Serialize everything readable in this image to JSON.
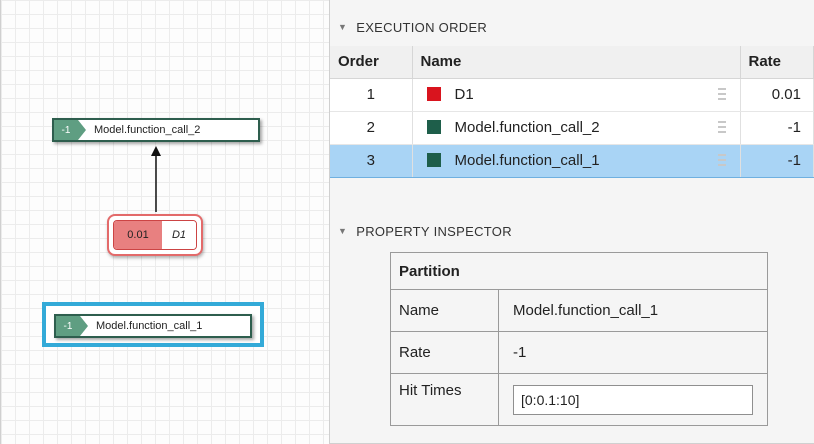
{
  "canvas": {
    "blocks": {
      "fc2": {
        "rate": "-1",
        "name": "Model.function_call_2"
      },
      "d1": {
        "rate": "0.01",
        "name": "D1"
      },
      "fc1": {
        "rate": "-1",
        "name": "Model.function_call_1"
      }
    }
  },
  "execution_order": {
    "title": "EXECUTION ORDER",
    "columns": {
      "order": "Order",
      "name": "Name",
      "rate": "Rate"
    },
    "rows": [
      {
        "order": "1",
        "name": "D1",
        "rate": "0.01",
        "color": "#d9141e"
      },
      {
        "order": "2",
        "name": "Model.function_call_2",
        "rate": "-1",
        "color": "#1e5e4a"
      },
      {
        "order": "3",
        "name": "Model.function_call_1",
        "rate": "-1",
        "color": "#1e5e4a"
      }
    ],
    "selected_row": "3"
  },
  "property_inspector": {
    "title": "PROPERTY INSPECTOR",
    "section": "Partition",
    "name_label": "Name",
    "name_value": "Model.function_call_1",
    "rate_label": "Rate",
    "rate_value": "-1",
    "hit_times_label": "Hit Times",
    "hit_times_value": "[0:0.1:10]"
  }
}
